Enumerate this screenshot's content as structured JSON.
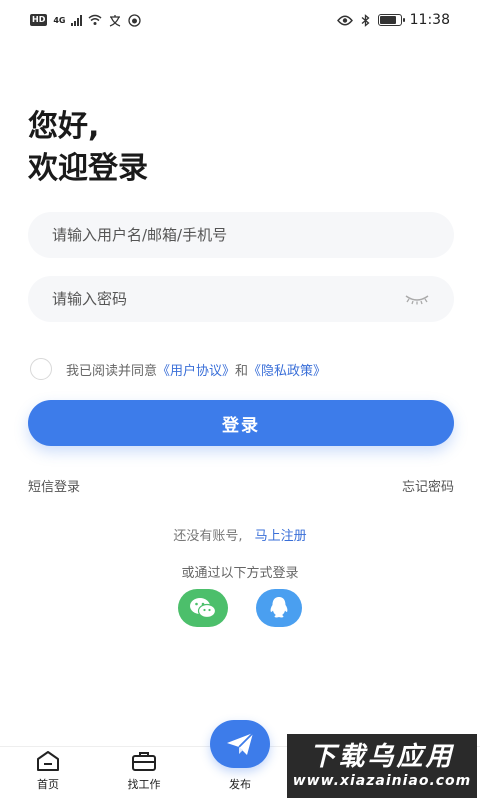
{
  "status": {
    "hd": "HD",
    "network": "4G",
    "time": "11:38",
    "battery_level": 0.8
  },
  "greeting": {
    "line1": "您好,",
    "line2": "欢迎登录"
  },
  "form": {
    "username_placeholder": "请输入用户名/邮箱/手机号",
    "password_placeholder": "请输入密码"
  },
  "agreement": {
    "prefix": "我已阅读并同意",
    "user_agreement": "《用户协议》",
    "and": "和",
    "privacy_policy": "《隐私政策》"
  },
  "login_button": "登录",
  "links": {
    "sms_login": "短信登录",
    "forgot_password": "忘记密码"
  },
  "register": {
    "prompt": "还没有账号,",
    "link": "马上注册"
  },
  "other_login": "或通过以下方式登录",
  "social": {
    "wechat_icon": "wechat-icon",
    "qq_icon": "qq-icon"
  },
  "tabs": [
    {
      "label": "首页",
      "icon": "home-icon"
    },
    {
      "label": "找工作",
      "icon": "briefcase-icon"
    },
    {
      "label": "发布",
      "icon": "send-icon"
    }
  ],
  "watermark": {
    "main": "下载乌应用",
    "sub": "www.xiazainiao.com"
  },
  "colors": {
    "primary": "#3d7cea",
    "link": "#3a6fd8",
    "wechat": "#4cbf6b",
    "qq": "#4a9ff0"
  }
}
